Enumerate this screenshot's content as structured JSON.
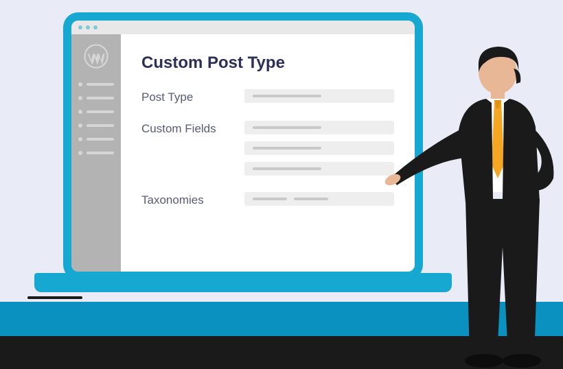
{
  "page": {
    "title": "Custom Post Type",
    "sections": [
      {
        "label": "Post Type",
        "field_count": 1
      },
      {
        "label": "Custom Fields",
        "field_count": 3
      },
      {
        "label": "Taxonomies",
        "field_count": 1
      }
    ]
  },
  "sidebar": {
    "item_count": 6
  },
  "colors": {
    "accent": "#17a8d1",
    "title": "#2c2f56",
    "label": "#585a7a"
  }
}
